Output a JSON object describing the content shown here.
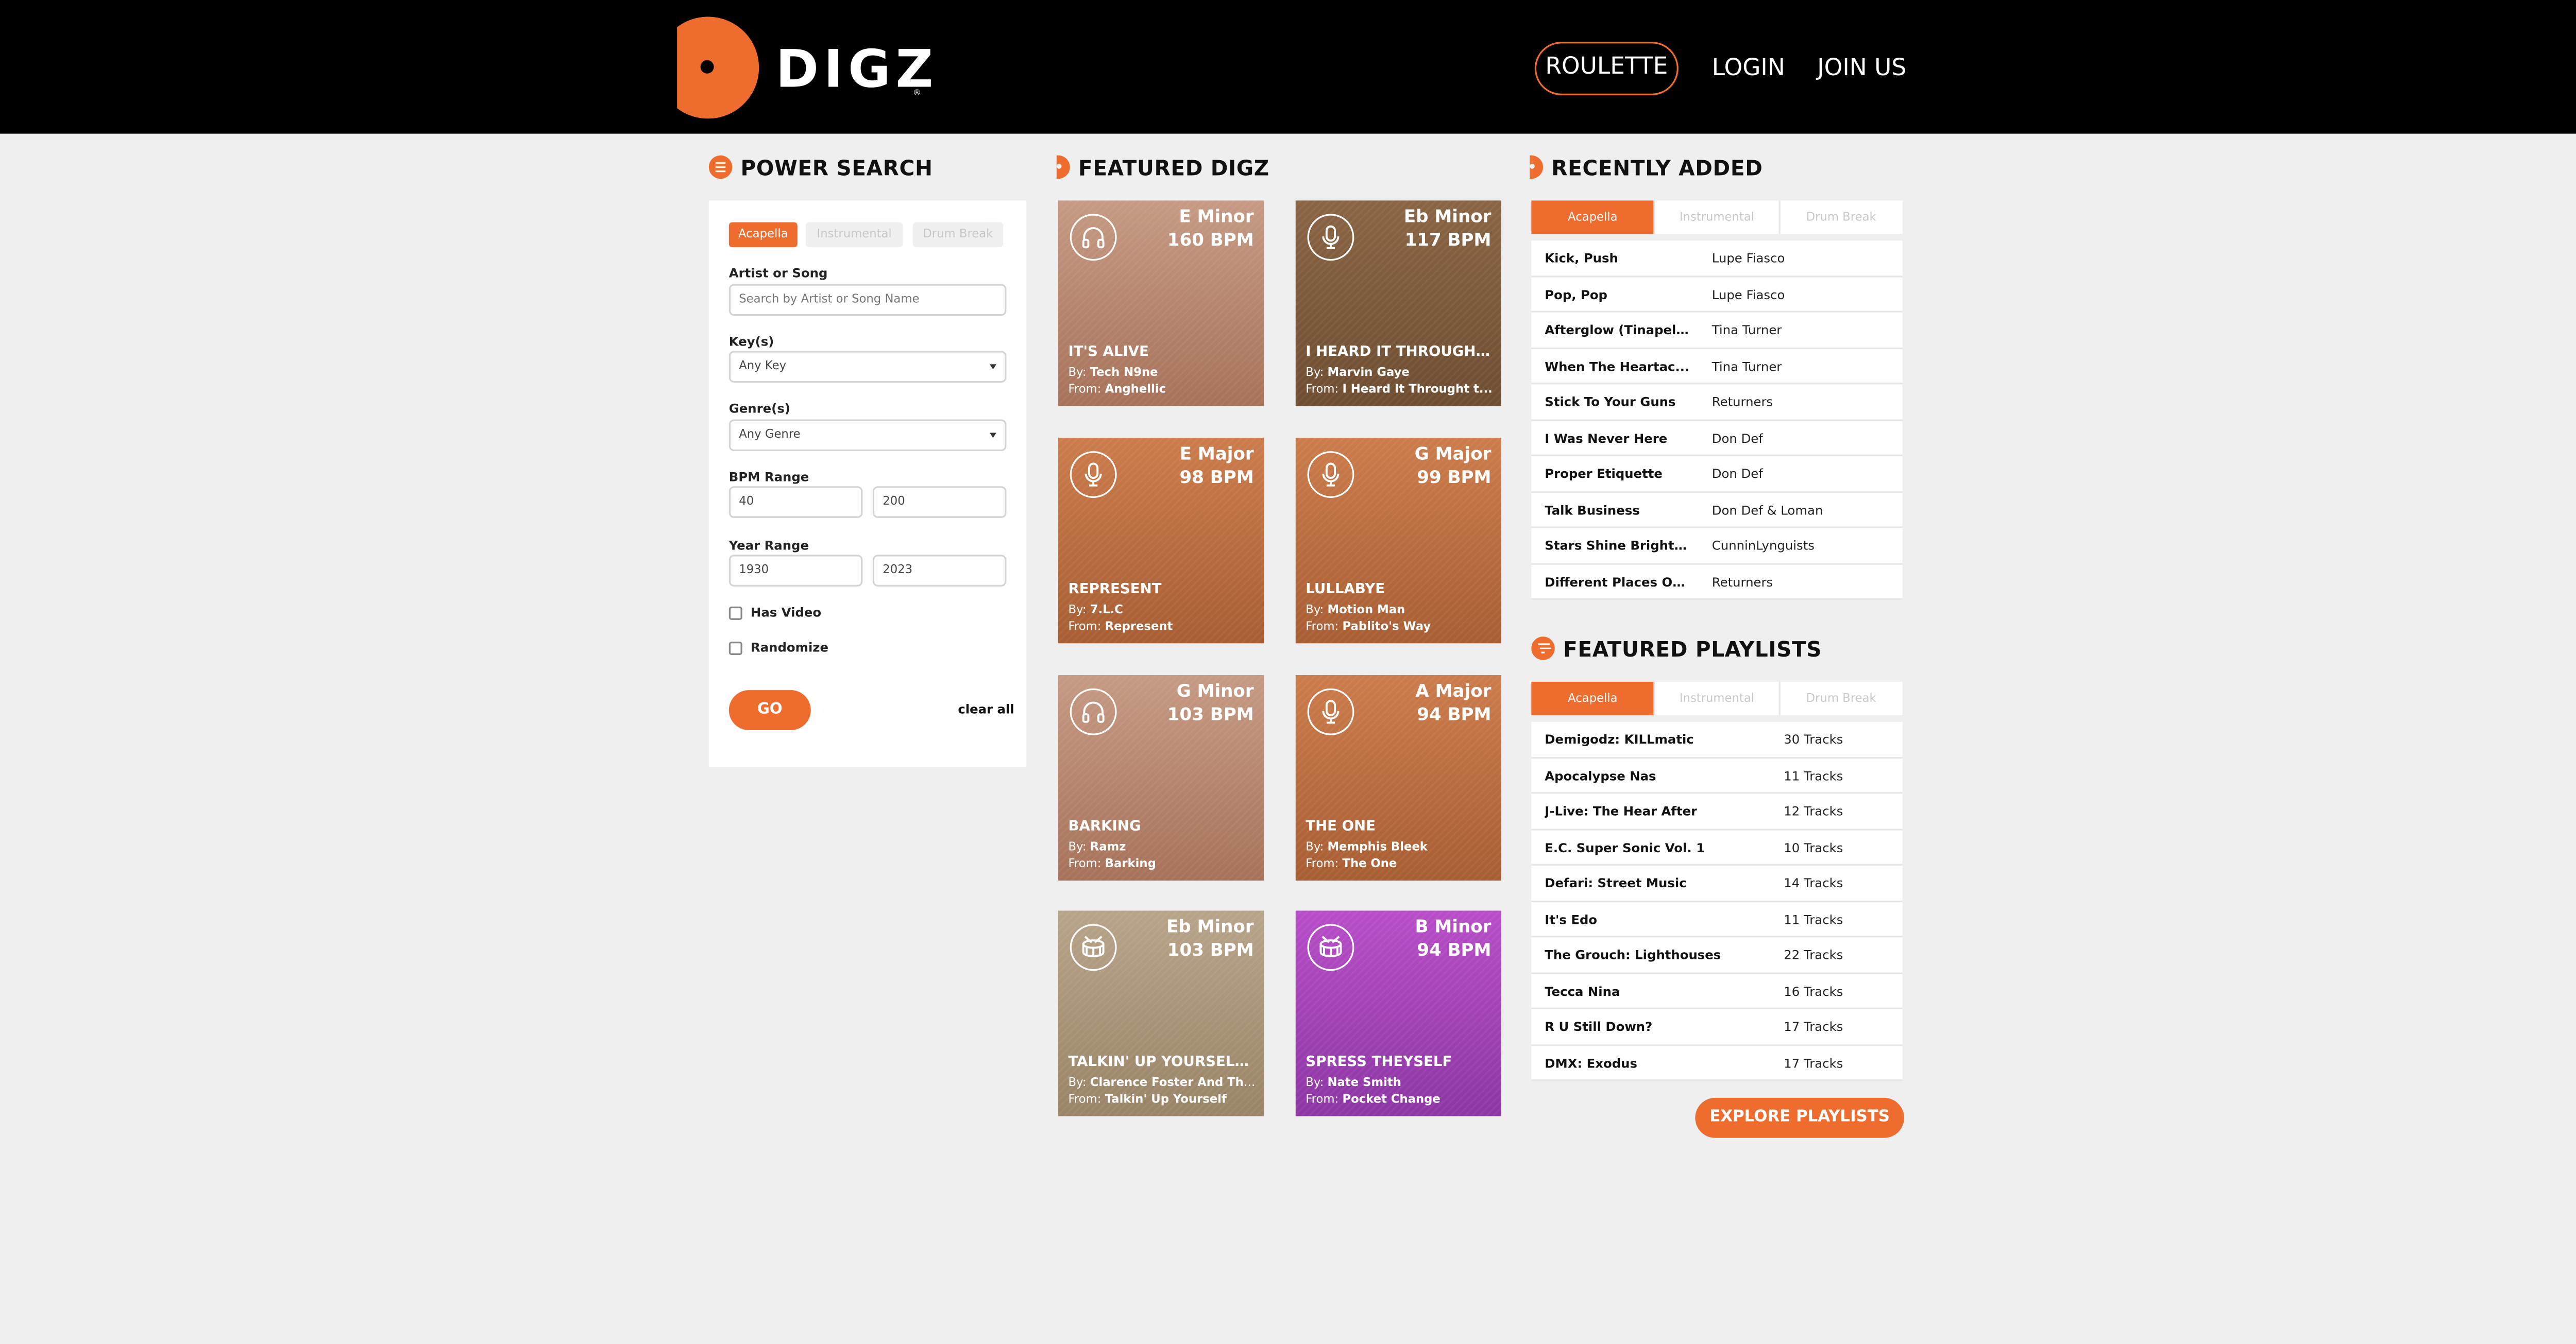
{
  "colors": {
    "accent": "#ef6c2f",
    "header_bg": "#000000",
    "page_bg": "#efefef"
  },
  "header": {
    "logo_text": "DIGZ",
    "logo_reg": "®",
    "nav": {
      "roulette": "ROULETTE",
      "login": "LOGIN",
      "join": "JOIN US"
    }
  },
  "power_search": {
    "title": "POWER SEARCH",
    "type_tabs": [
      "Acapella",
      "Instrumental",
      "Drum Break"
    ],
    "artist_label": "Artist or Song",
    "artist_placeholder": "Search by Artist or Song Name",
    "key_label": "Key(s)",
    "key_value": "Any Key",
    "genre_label": "Genre(s)",
    "genre_value": "Any Genre",
    "bpm_label": "BPM Range",
    "bpm_min": "40",
    "bpm_max": "200",
    "year_label": "Year Range",
    "year_min": "1930",
    "year_max": "2023",
    "has_video_label": "Has Video",
    "randomize_label": "Randomize",
    "go_label": "GO",
    "clear_label": "clear all"
  },
  "featured": {
    "title": "FEATURED DIGZ",
    "cards": [
      {
        "icon": "headphones-icon",
        "key": "E Minor",
        "bpm": "160 BPM",
        "title": "IT'S ALIVE",
        "by_label": "By: ",
        "by": "Tech N9ne",
        "from_label": "From: ",
        "from": "Anghellic",
        "color_top": "#c69a84",
        "color_bottom": "#a7725a"
      },
      {
        "icon": "microphone-icon",
        "key": "Eb Minor",
        "bpm": "117 BPM",
        "title": "I HEARD IT THROUGH T...",
        "by_label": "By: ",
        "by": "Marvin Gaye",
        "from_label": "From: ",
        "from": "I Heard It Throught t...",
        "color_top": "#8a6545",
        "color_bottom": "#6e4d31"
      },
      {
        "icon": "microphone-icon",
        "key": "E Major",
        "bpm": "98 BPM",
        "title": "REPRESENT",
        "by_label": "By: ",
        "by": "7.L.C",
        "from_label": "From: ",
        "from": "Represent",
        "color_top": "#cc7c4c",
        "color_bottom": "#a85e33"
      },
      {
        "icon": "microphone-icon",
        "key": "G Major",
        "bpm": "99 BPM",
        "title": "LULLABYE",
        "by_label": "By: ",
        "by": "Motion Man",
        "from_label": "From: ",
        "from": "Pablito's Way",
        "color_top": "#cc7c4c",
        "color_bottom": "#a85e33"
      },
      {
        "icon": "headphones-icon",
        "key": "G Minor",
        "bpm": "103 BPM",
        "title": "BARKING",
        "by_label": "By: ",
        "by": "Ramz",
        "from_label": "From: ",
        "from": "Barking",
        "color_top": "#c69a84",
        "color_bottom": "#a7725a"
      },
      {
        "icon": "microphone-icon",
        "key": "A Major",
        "bpm": "94 BPM",
        "title": "THE ONE",
        "by_label": "By: ",
        "by": "Memphis Bleek",
        "from_label": "From: ",
        "from": "The One",
        "color_top": "#cc7c4c",
        "color_bottom": "#a85e33"
      },
      {
        "icon": "drum-icon",
        "key": "Eb Minor",
        "bpm": "103 BPM",
        "title": "TALKIN' UP YOURSELF ...",
        "by_label": "By: ",
        "by": "Clarence Foster And Th...",
        "from_label": "From: ",
        "from": "Talkin' Up Yourself",
        "color_top": "#b8a48a",
        "color_bottom": "#9a8467"
      },
      {
        "icon": "drum-icon",
        "key": "B Minor",
        "bpm": "94 BPM",
        "title": "SPRESS THEYSELF",
        "by_label": "By: ",
        "by": "Nate Smith",
        "from_label": "From: ",
        "from": "Pocket Change",
        "color_top": "#b84ec8",
        "color_bottom": "#8c36a3"
      }
    ]
  },
  "recently_added": {
    "title": "RECENTLY ADDED",
    "tabs": [
      "Acapella",
      "Instrumental",
      "Drum Break"
    ],
    "rows": [
      {
        "song": "Kick, Push",
        "artist": "Lupe Fiasco"
      },
      {
        "song": "Pop, Pop",
        "artist": "Lupe Fiasco"
      },
      {
        "song": "Afterglow (Tinapell...",
        "artist": "Tina Turner"
      },
      {
        "song": "When The Heartac...",
        "artist": "Tina Turner"
      },
      {
        "song": "Stick To Your Guns",
        "artist": "Returners"
      },
      {
        "song": "I Was Never Here",
        "artist": "Don Def"
      },
      {
        "song": "Proper Etiquette",
        "artist": "Don Def"
      },
      {
        "song": "Talk Business",
        "artist": "Don Def & Loman"
      },
      {
        "song": "Stars Shine Brighte...",
        "artist": "CunninLynguists"
      },
      {
        "song": "Different Places On...",
        "artist": "Returners"
      }
    ]
  },
  "featured_playlists": {
    "title": "FEATURED PLAYLISTS",
    "tabs": [
      "Acapella",
      "Instrumental",
      "Drum Break"
    ],
    "rows": [
      {
        "name": "Demigodz: KILLmatic",
        "tracks": "30 Tracks"
      },
      {
        "name": "Apocalypse Nas",
        "tracks": "11 Tracks"
      },
      {
        "name": "J-Live: The Hear After",
        "tracks": "12 Tracks"
      },
      {
        "name": "E.C. Super Sonic Vol. 1",
        "tracks": "10 Tracks"
      },
      {
        "name": "Defari: Street Music",
        "tracks": "14 Tracks"
      },
      {
        "name": "It's Edo",
        "tracks": "11 Tracks"
      },
      {
        "name": "The Grouch: Lighthouses",
        "tracks": "22 Tracks"
      },
      {
        "name": "Tecca Nina",
        "tracks": "16 Tracks"
      },
      {
        "name": "R U Still Down?",
        "tracks": "17 Tracks"
      },
      {
        "name": "DMX: Exodus",
        "tracks": "17 Tracks"
      }
    ],
    "explore_label": "EXPLORE PLAYLISTS"
  }
}
